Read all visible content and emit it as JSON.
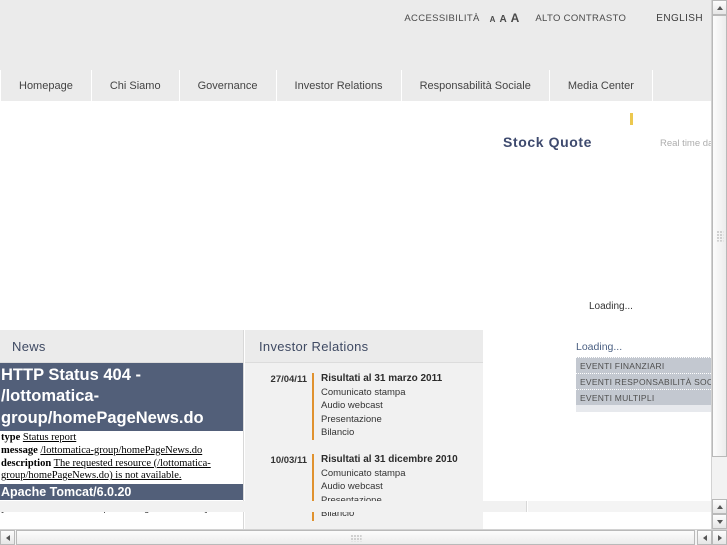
{
  "topbar": {
    "accessibility_label": "ACCESSIBILITÀ",
    "font_small": "A",
    "font_medium": "A",
    "font_large": "A",
    "high_contrast_label": "ALTO CONTRASTO",
    "language_label": "ENGLISH"
  },
  "nav": {
    "items": [
      {
        "label": "Homepage"
      },
      {
        "label": "Chi Siamo"
      },
      {
        "label": "Governance"
      },
      {
        "label": "Investor Relations"
      },
      {
        "label": "Responsabilità Sociale"
      },
      {
        "label": "Media Center"
      }
    ]
  },
  "stock": {
    "title": "Stock Quote",
    "realtime_note": "Real time da"
  },
  "sidebar": {
    "loading_center": "Loading...",
    "loading_events": "Loading...",
    "events": [
      {
        "label": "EVENTI FINANZIARI"
      },
      {
        "label": "EVENTI RESPONSABILITÀ SOCIALE"
      },
      {
        "label": "EVENTI MULTIPLI"
      }
    ]
  },
  "news_panel": {
    "title": "News",
    "error": {
      "heading": "HTTP Status 404 - /lottomatica-group/homePageNews.do",
      "type_label": "type",
      "type_value": "Status report",
      "message_label": "message",
      "message_value": "/lottomatica-group/homePageNews.do",
      "description_label": "description",
      "description_value": "The requested resource (/lottomatica-group/homePageNews.do) is not available.",
      "server": "Apache Tomcat/6.0.20",
      "directive_note": "[an error occurred while processing this directive]"
    }
  },
  "ir_panel": {
    "title": "Investor Relations",
    "entries": [
      {
        "date": "27/04/11",
        "headline": "Risultati al 31 marzo 2011",
        "links": [
          {
            "label": "Comunicato stampa"
          },
          {
            "label": "Audio webcast"
          },
          {
            "label": "Presentazione"
          },
          {
            "label": "Bilancio"
          }
        ]
      },
      {
        "date": "10/03/11",
        "headline": "Risultati al 31 dicembre 2010",
        "links": [
          {
            "label": "Comunicato stampa"
          },
          {
            "label": "Audio webcast"
          },
          {
            "label": "Presentazione"
          },
          {
            "label": "Bilancio"
          }
        ]
      }
    ]
  },
  "colors": {
    "header_bg": "#ebebeb",
    "error_bg": "#525f79",
    "accent_orange": "#e0922f",
    "accent_yellow": "#ecc84f",
    "title_navy": "#3e4a6e",
    "event_bg": "#c3c8d0"
  }
}
